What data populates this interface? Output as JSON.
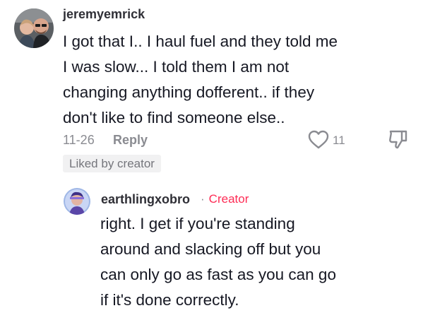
{
  "comment": {
    "username": "jeremyemrick",
    "avatar_icon": "user-photo-avatar",
    "text_lines": [
      "I got that I.. I haul fuel and they told me",
      "I was slow... I told them I am not",
      "changing anything dofferent.. if they",
      "don't like to find someone else.."
    ],
    "date": "11-26",
    "reply_label": "Reply",
    "like_icon": "heart-outline-icon",
    "like_count": "11",
    "dislike_icon": "thumbs-down-outline-icon",
    "liked_badge": "Liked by creator"
  },
  "reply": {
    "username": "earthlingxobro",
    "separator": "·",
    "creator_label": "Creator",
    "avatar_icon": "user-photo-avatar",
    "text_lines": [
      "right. I get if you're standing",
      "around and slacking off but you",
      "can only go as fast as you can go",
      "if it's done correctly."
    ]
  },
  "colors": {
    "primary_text": "#161823",
    "secondary_text": "#8a8b91",
    "creator_accent": "#fe2c55",
    "badge_bg": "#f1f1f2"
  }
}
